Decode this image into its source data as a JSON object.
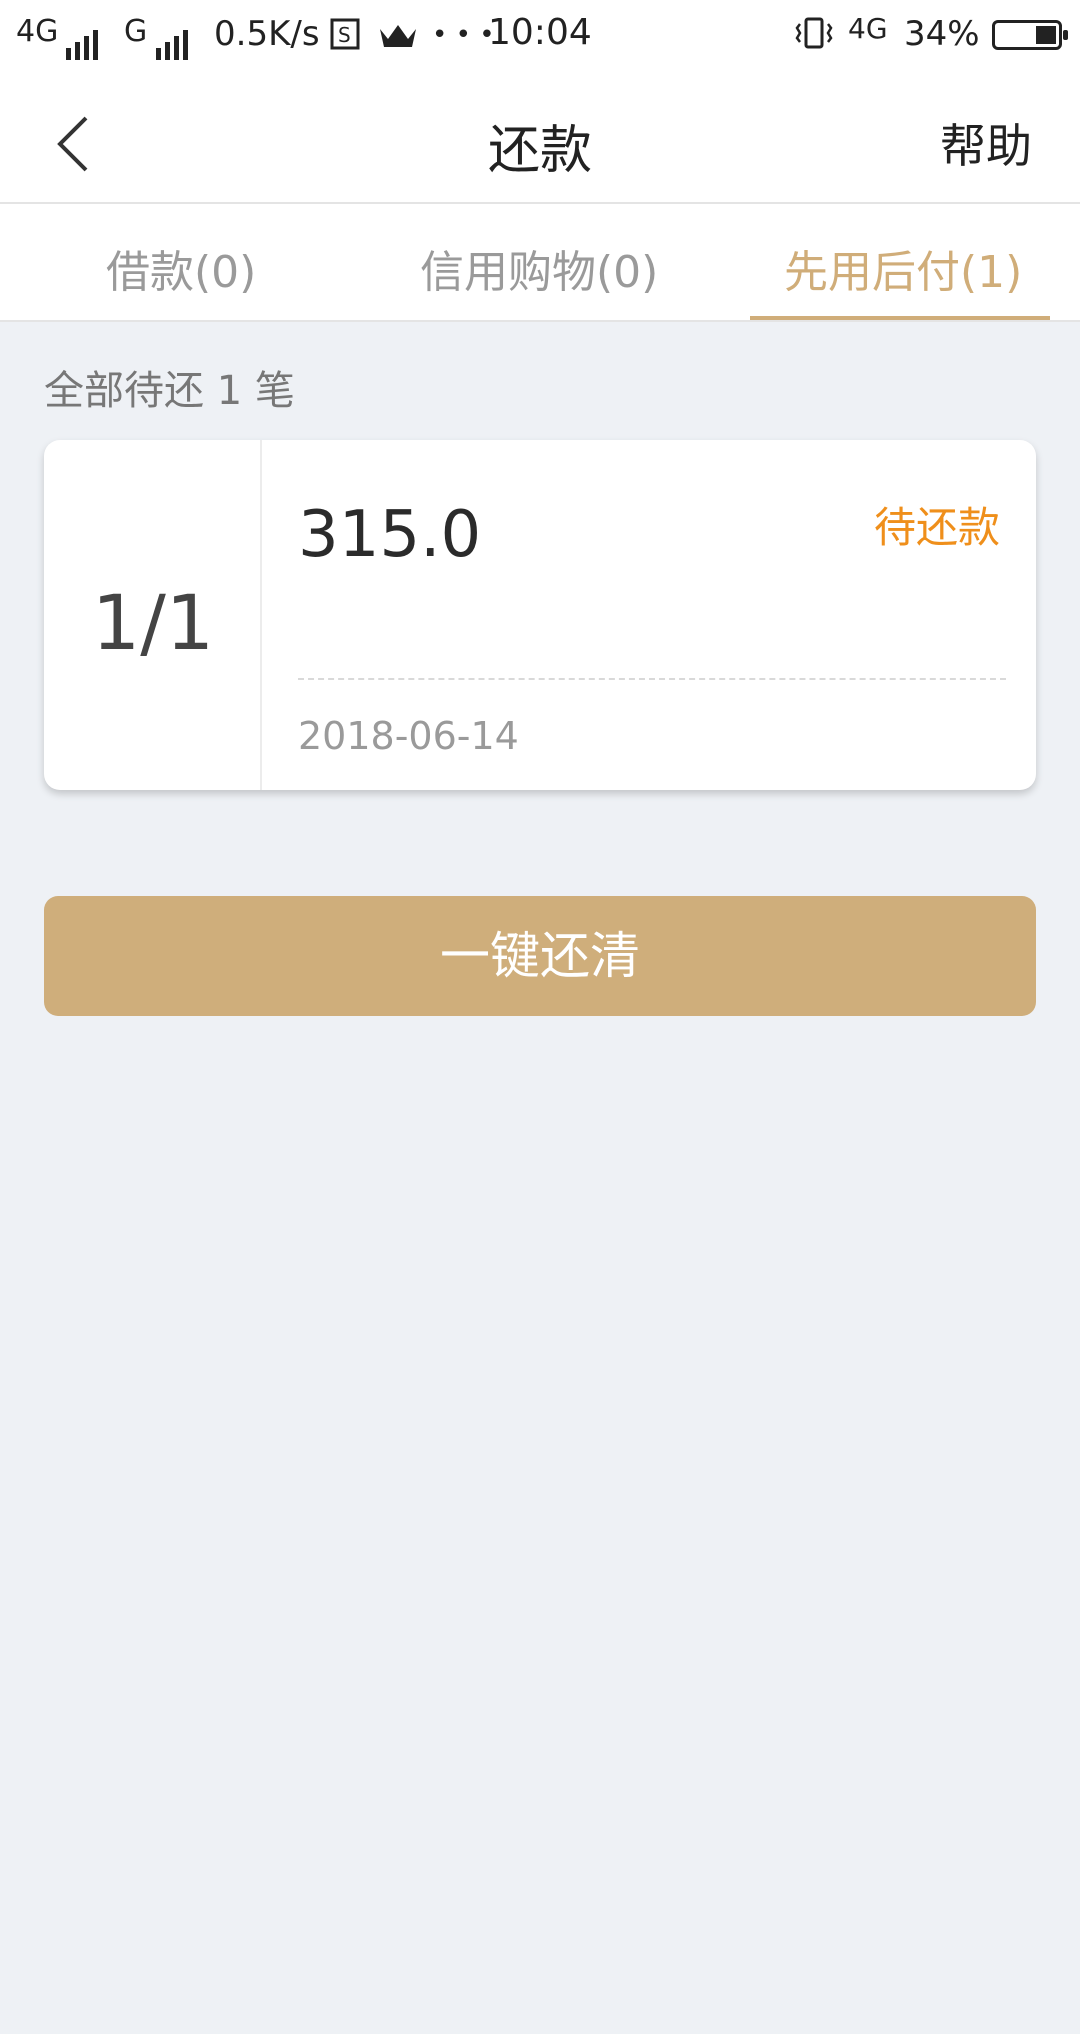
{
  "status_bar": {
    "network1": "4G",
    "network2": "G",
    "speed": "0.5K/s",
    "extra": "• • •",
    "time": "10:04",
    "network3": "4G",
    "battery": "34%"
  },
  "nav": {
    "title": "还款",
    "help": "帮助"
  },
  "tabs": [
    {
      "label": "借款(0)",
      "active": false
    },
    {
      "label": "信用购物(0)",
      "active": false
    },
    {
      "label": "先用后付(1)",
      "active": true
    }
  ],
  "summary": "全部待还 1 笔",
  "bill": {
    "index": "1/1",
    "amount": "315.0",
    "status": "待还款",
    "date": "2018-06-14"
  },
  "pay_button": "一键还清",
  "colors": {
    "accent": "#d0ad79",
    "status_orange": "#ef8f1b",
    "background": "#eef1f5"
  },
  "icons": [
    "back-icon",
    "sim-icon",
    "crown-icon",
    "vibrate-icon"
  ]
}
